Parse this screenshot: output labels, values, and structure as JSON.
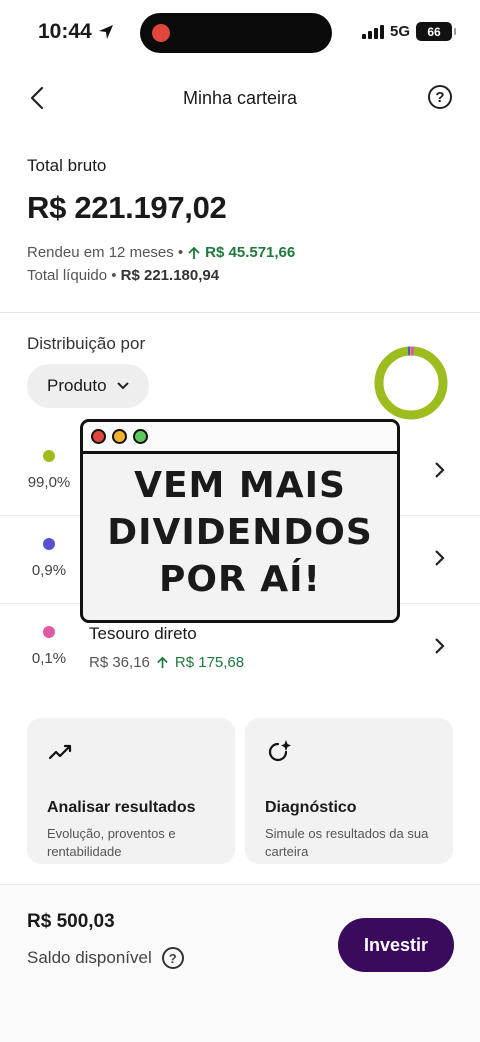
{
  "status_bar": {
    "time": "10:44",
    "network": "5G",
    "battery": "66"
  },
  "nav": {
    "title": "Minha carteira"
  },
  "summary": {
    "gross_label": "Total bruto",
    "gross_value": "R$ 221.197,02",
    "yield_prefix": "Rendeu em 12 meses •",
    "yield_value": "R$ 45.571,66",
    "net_prefix": "Total líquido •",
    "net_value": "R$ 221.180,94"
  },
  "distribution": {
    "label": "Distribuição por",
    "selector": "Produto",
    "items": [
      {
        "percent": "99,0%",
        "color": "#9dbd1f"
      },
      {
        "percent": "0,9%",
        "color": "#5b4fd1"
      },
      {
        "percent": "0,1%",
        "color": "#e05aa8",
        "title": "Tesouro direto",
        "invested": "R$ 36,16",
        "yield": "R$ 175,68"
      }
    ],
    "donut_colors": [
      "#9dbd1f",
      "#5b4fd1",
      "#e05aa8"
    ]
  },
  "popup": {
    "line1": "VEM MAIS",
    "line2": "DIVIDENDOS",
    "line3": "POR AÍ!"
  },
  "cards": [
    {
      "title": "Analisar resultados",
      "desc": "Evolução, proventos e rentabilidade",
      "icon": "trend-icon"
    },
    {
      "title": "Diagnóstico",
      "desc": "Simule os resultados da sua carteira",
      "icon": "diagnostic-sparkle-icon"
    }
  ],
  "bottom": {
    "balance": "R$ 500,03",
    "available_label": "Saldo disponível",
    "invest_label": "Investir"
  }
}
